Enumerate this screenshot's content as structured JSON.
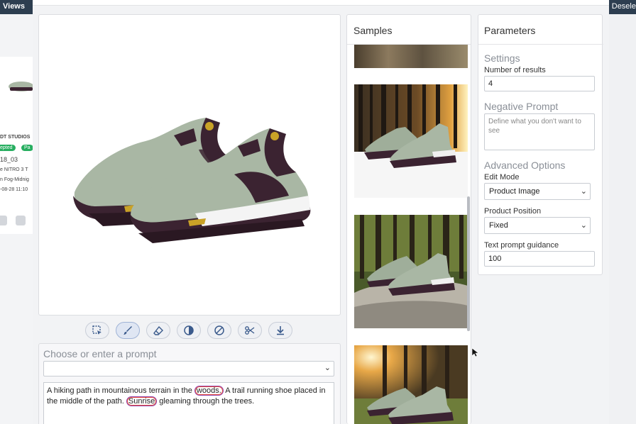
{
  "background": {
    "views_label": "Views",
    "deselect_label": "Desele",
    "card_lines": [
      "DT STUDIOS",
      "18_03",
      "e NITRO 3 T",
      "n Fog-Midnig",
      "-08-28 11:10"
    ],
    "badges": [
      "epted",
      "Pa"
    ]
  },
  "image_panel": {
    "image_icon": "running-shoe-image"
  },
  "toolbar": {
    "buttons": [
      {
        "name": "select-area",
        "icon": "select-icon"
      },
      {
        "name": "brush",
        "icon": "brush-icon"
      },
      {
        "name": "eraser",
        "icon": "eraser-icon"
      },
      {
        "name": "contrast",
        "icon": "contrast-icon"
      },
      {
        "name": "clear",
        "icon": "block-icon"
      },
      {
        "name": "cut",
        "icon": "scissors-icon"
      },
      {
        "name": "download",
        "icon": "download-icon"
      }
    ]
  },
  "prompt": {
    "title": "Choose or enter a prompt",
    "select_value": "",
    "text_part1": "A hiking path in mountainous terrain in the ",
    "highlight1": "woods.",
    "text_part2": " A trail running shoe placed in the middle of the path. ",
    "highlight2": "Sunrise",
    "text_part3": " gleaming through the trees."
  },
  "samples": {
    "title": "Samples"
  },
  "parameters": {
    "title": "Parameters",
    "settings_title": "Settings",
    "num_results_label": "Number of results",
    "num_results_value": "4",
    "negative_prompt_title": "Negative Prompt",
    "negative_prompt_placeholder": "Define what you don't want to see",
    "advanced_title": "Advanced Options",
    "edit_mode_label": "Edit Mode",
    "edit_mode_value": "Product Image",
    "product_position_label": "Product Position",
    "product_position_value": "Fixed",
    "guidance_label": "Text prompt guidance",
    "guidance_value": "100"
  },
  "colors": {
    "shoe_upper": "#a9b7a4",
    "shoe_dark": "#3b2331",
    "shoe_sole": "#f4f4f4",
    "accent_yellow": "#c9a227",
    "highlight_border": "#8e44ad"
  }
}
